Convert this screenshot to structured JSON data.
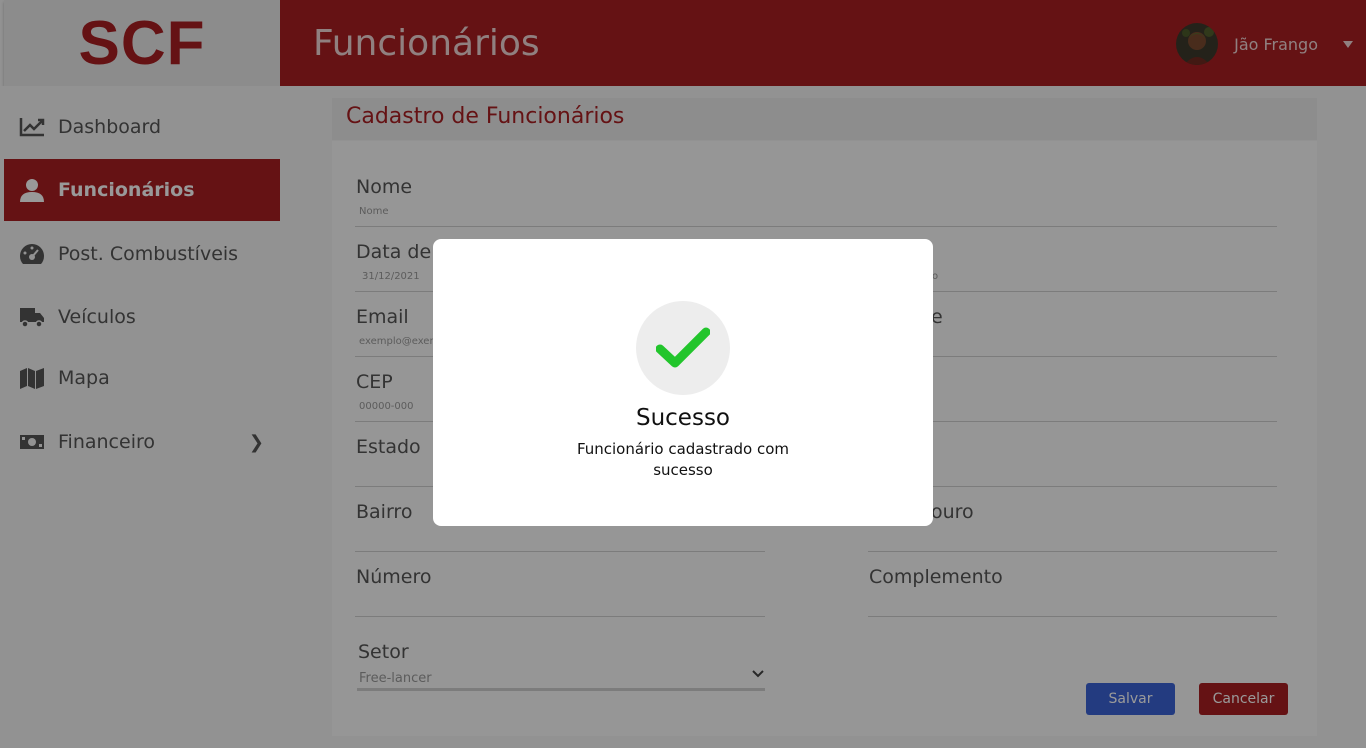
{
  "app": {
    "logo": "SCF",
    "page_title": "Funcionários"
  },
  "user": {
    "name": "Jão Frango"
  },
  "sidebar": {
    "items": [
      {
        "label": "Dashboard",
        "icon": "chart-line-icon"
      },
      {
        "label": "Funcionários",
        "icon": "user-icon",
        "active": true
      },
      {
        "label": "Post. Combustíveis",
        "icon": "speedometer-icon"
      },
      {
        "label": "Veículos",
        "icon": "truck-icon"
      },
      {
        "label": "Mapa",
        "icon": "map-icon"
      },
      {
        "label": "Financeiro",
        "icon": "money-bill-icon",
        "has_submenu": true
      }
    ]
  },
  "form": {
    "section_title": "Cadastro de Funcionários",
    "fields": {
      "nome": {
        "label": "Nome",
        "placeholder": "Nome"
      },
      "data_nascimento": {
        "label": "Data de n",
        "placeholder": "31/12/2021"
      },
      "telefone_partial": {
        "placeholder": "o"
      },
      "email": {
        "label": "Email",
        "placeholder": "exemplo@exemp"
      },
      "right_row3_partial": {
        "label": "e"
      },
      "cep": {
        "label": "CEP",
        "placeholder": "00000-000"
      },
      "estado": {
        "label": "Estado"
      },
      "bairro": {
        "label": "Bairro"
      },
      "logradouro_partial": {
        "label": "ouro"
      },
      "numero": {
        "label": "Número"
      },
      "complemento": {
        "label": "Complemento"
      },
      "setor": {
        "label": "Setor",
        "value": "Free-lancer"
      }
    },
    "buttons": {
      "save": "Salvar",
      "cancel": "Cancelar"
    }
  },
  "modal": {
    "title": "Sucesso",
    "message": "Funcionário cadastrado com sucesso",
    "icon": "check-icon"
  },
  "colors": {
    "brand": "#a81f22",
    "primary_button": "#3b63d6",
    "success": "#22c52c"
  }
}
